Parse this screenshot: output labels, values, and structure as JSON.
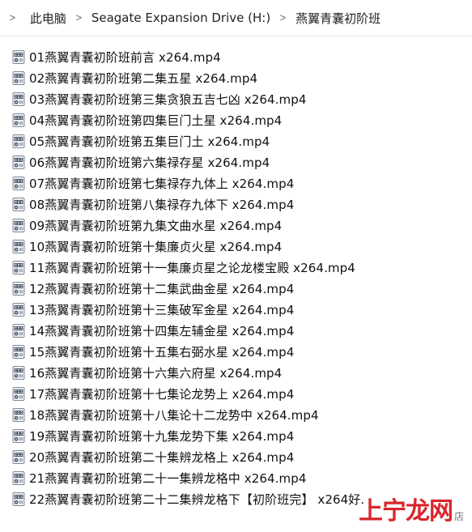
{
  "breadcrumb": [
    "此电脑",
    "Seagate Expansion Drive (H:)",
    "燕翼青囊初阶班"
  ],
  "files": [
    "01燕翼青囊初阶班前言  x264.mp4",
    "02燕翼青囊初阶班第二集五星  x264.mp4",
    "03燕翼青囊初阶班第三集贪狼五吉七凶  x264.mp4",
    "04燕翼青囊初阶班第四集巨门土星  x264.mp4",
    "05燕翼青囊初阶班第五集巨门土  x264.mp4",
    "06燕翼青囊初阶班第六集禄存星  x264.mp4",
    "07燕翼青囊初阶班第七集禄存九体上  x264.mp4",
    "08燕翼青囊初阶班第八集禄存九体下  x264.mp4",
    "09燕翼青囊初阶班第九集文曲水星  x264.mp4",
    "10燕翼青囊初阶班第十集廉贞火星  x264.mp4",
    "11燕翼青囊初阶班第十一集廉贞星之论龙楼宝殿   x264.mp4",
    "12燕翼青囊初阶班第十二集武曲金星  x264.mp4",
    "13燕翼青囊初阶班第十三集破军金星  x264.mp4",
    "14燕翼青囊初阶班第十四集左辅金星  x264.mp4",
    "15燕翼青囊初阶班第十五集右弼水星  x264.mp4",
    "16燕翼青囊初阶班第十六集六府星  x264.mp4",
    "17燕翼青囊初阶班第十七集论龙势上  x264.mp4",
    "18燕翼青囊初阶班第十八集论十二龙势中  x264.mp4",
    "19燕翼青囊初阶班第十九集龙势下集  x264.mp4",
    "20燕翼青囊初阶班第二十集辨龙格上  x264.mp4",
    "21燕翼青囊初阶班第二十一集辨龙格中  x264.mp4",
    "22燕翼青囊初阶班第二十二集辨龙格下【初阶班完】  x264好."
  ],
  "watermark": {
    "main": "上宁龙网",
    "sub": "店"
  },
  "colors": {
    "watermark": "#d8262d",
    "icon_body": "#7f8a99",
    "icon_film": "#4a5563"
  }
}
